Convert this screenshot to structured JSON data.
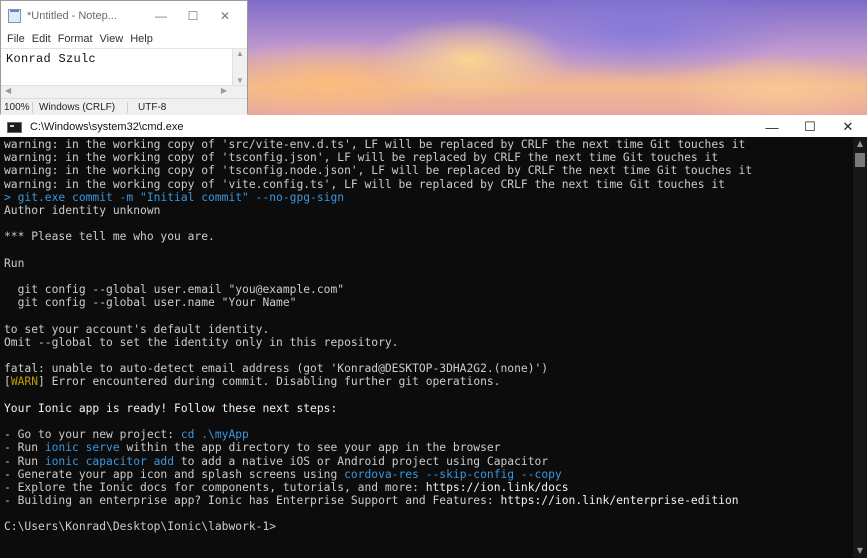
{
  "notepad": {
    "title": "*Untitled - Notep...",
    "controls": {
      "minimize": "—",
      "maximize": "☐",
      "close": "✕"
    },
    "menu": [
      "File",
      "Edit",
      "Format",
      "View",
      "Help"
    ],
    "content": "Konrad Szulc",
    "status": {
      "zoom": "100%",
      "line_ending": "Windows (CRLF)",
      "encoding": "UTF-8"
    }
  },
  "cmd": {
    "title": "C:\\Windows\\system32\\cmd.exe",
    "controls": {
      "minimize": "—",
      "maximize": "☐",
      "close": "✕"
    },
    "lines": [
      [
        {
          "t": "warning: in the working copy of 'src/vite-env.d.ts', LF will be replaced by CRLF the next time Git touches it",
          "c": ""
        }
      ],
      [
        {
          "t": "warning: in the working copy of 'tsconfig.json', LF will be replaced by CRLF the next time Git touches it",
          "c": ""
        }
      ],
      [
        {
          "t": "warning: in the working copy of 'tsconfig.node.json', LF will be replaced by CRLF the next time Git touches it",
          "c": ""
        }
      ],
      [
        {
          "t": "warning: in the working copy of 'vite.config.ts', LF will be replaced by CRLF the next time Git touches it",
          "c": ""
        }
      ],
      [
        {
          "t": "> git.exe commit -m \"Initial commit\" --no-gpg-sign",
          "c": "cyan"
        }
      ],
      [
        {
          "t": "Author identity unknown",
          "c": ""
        }
      ],
      [
        {
          "t": "",
          "c": ""
        }
      ],
      [
        {
          "t": "*** Please tell me who you are.",
          "c": ""
        }
      ],
      [
        {
          "t": "",
          "c": ""
        }
      ],
      [
        {
          "t": "Run",
          "c": ""
        }
      ],
      [
        {
          "t": "",
          "c": ""
        }
      ],
      [
        {
          "t": "  git config --global user.email \"you@example.com\"",
          "c": ""
        }
      ],
      [
        {
          "t": "  git config --global user.name \"Your Name\"",
          "c": ""
        }
      ],
      [
        {
          "t": "",
          "c": ""
        }
      ],
      [
        {
          "t": "to set your account's default identity.",
          "c": ""
        }
      ],
      [
        {
          "t": "Omit --global to set the identity only in this repository.",
          "c": ""
        }
      ],
      [
        {
          "t": "",
          "c": ""
        }
      ],
      [
        {
          "t": "fatal: unable to auto-detect email address (got 'Konrad@DESKTOP-3DHA2G2.(none)')",
          "c": ""
        }
      ],
      [
        {
          "t": "[",
          "c": ""
        },
        {
          "t": "WARN",
          "c": "yellow"
        },
        {
          "t": "] Error encountered during commit. Disabling further git operations.",
          "c": ""
        }
      ],
      [
        {
          "t": "",
          "c": ""
        }
      ],
      [
        {
          "t": "Your Ionic app is ready! Follow these next steps:",
          "c": "white"
        }
      ],
      [
        {
          "t": "",
          "c": ""
        }
      ],
      [
        {
          "t": "- Go to your new project: ",
          "c": ""
        },
        {
          "t": "cd .\\myApp",
          "c": "cyan"
        }
      ],
      [
        {
          "t": "- Run ",
          "c": ""
        },
        {
          "t": "ionic serve",
          "c": "cyan"
        },
        {
          "t": " within the app directory to see your app in the browser",
          "c": ""
        }
      ],
      [
        {
          "t": "- Run ",
          "c": ""
        },
        {
          "t": "ionic capacitor add",
          "c": "cyan"
        },
        {
          "t": " to add a native iOS or Android project using Capacitor",
          "c": ""
        }
      ],
      [
        {
          "t": "- Generate your app icon and splash screens using ",
          "c": ""
        },
        {
          "t": "cordova-res --skip-config --copy",
          "c": "cyan"
        }
      ],
      [
        {
          "t": "- Explore the Ionic docs for components, tutorials, and more: ",
          "c": ""
        },
        {
          "t": "https://ion.link/docs",
          "c": "white"
        }
      ],
      [
        {
          "t": "- Building an enterprise app? Ionic has Enterprise Support and Features: ",
          "c": ""
        },
        {
          "t": "https://ion.link/enterprise-edition",
          "c": "white"
        }
      ],
      [
        {
          "t": "",
          "c": ""
        }
      ],
      [
        {
          "t": "C:\\Users\\Konrad\\Desktop\\Ionic\\labwork-1>",
          "c": ""
        }
      ]
    ]
  },
  "colors": {
    "console_bg": "#0c0c0c",
    "console_fg": "#cccccc",
    "cyan": "#3a96dd",
    "yellow": "#c19c00"
  }
}
